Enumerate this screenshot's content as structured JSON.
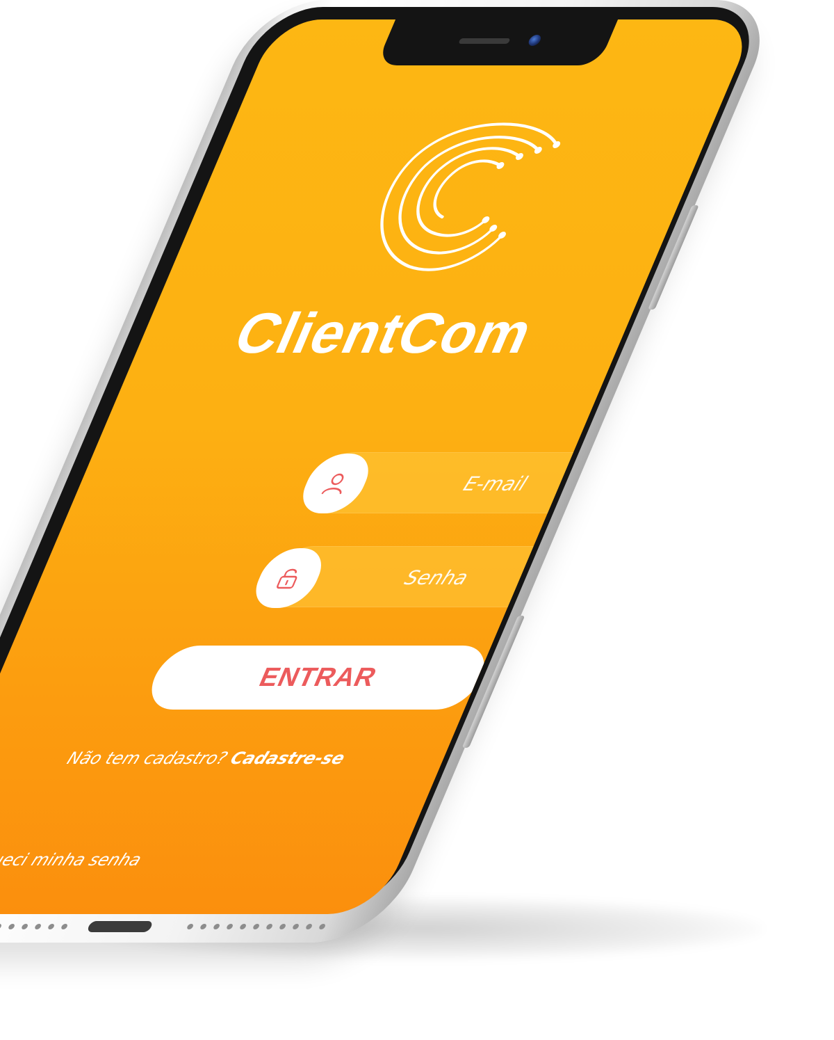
{
  "app": {
    "brand_name": "ClientCom"
  },
  "form": {
    "email_placeholder": "E-mail",
    "email_value": "",
    "password_placeholder": "Senha",
    "password_value": "",
    "email_icon": "user-icon",
    "password_icon": "lock-icon",
    "submit_label": "ENTRAR"
  },
  "signup": {
    "prompt": "Não tem cadastro? ",
    "link_label": "Cadastre-se"
  },
  "forgot": {
    "link_label": "Esqueci minha senha"
  },
  "colors": {
    "background_top": "#fdb713",
    "background_bottom": "#fb8f0d",
    "accent": "#ec5b5c",
    "text": "#ffffff"
  }
}
